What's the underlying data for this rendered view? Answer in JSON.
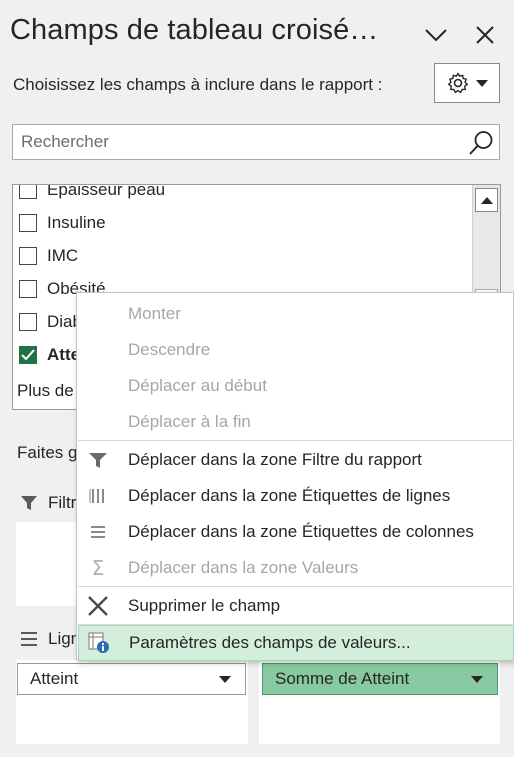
{
  "pane": {
    "title": "Champs de tableau croisé…",
    "choose_label": "Choisissez les champs à inclure dans le rapport :",
    "icons": {
      "collapse": "chevron-down-icon",
      "close": "close-icon",
      "settings": "gear-icon",
      "search": "search-icon"
    }
  },
  "search": {
    "placeholder": "Rechercher",
    "value": ""
  },
  "fields": [
    {
      "label": "Épaisseur peau",
      "checked": false
    },
    {
      "label": "Insuline",
      "checked": false
    },
    {
      "label": "IMC",
      "checked": false
    },
    {
      "label": "Obésité",
      "checked": false
    },
    {
      "label": "Diab",
      "checked": false
    },
    {
      "label": "Atte",
      "checked": true
    }
  ],
  "more_tables": "Plus de",
  "drag_label": "Faites g",
  "areas": {
    "filters_label": "Filtr",
    "rows_label": "Lign",
    "rows_field": "Atteint",
    "values_field": "Somme de Atteint"
  },
  "context_menu": {
    "items": [
      {
        "label": "Monter",
        "disabled": true
      },
      {
        "label": "Descendre",
        "disabled": true
      },
      {
        "label": "Déplacer au début",
        "disabled": true
      },
      {
        "label": "Déplacer à la fin",
        "disabled": true
      },
      {
        "label": "Déplacer dans la zone Filtre du rapport",
        "disabled": false,
        "icon": "filter-icon"
      },
      {
        "label": "Déplacer dans la zone Étiquettes de lignes",
        "disabled": false,
        "icon": "row-labels-icon"
      },
      {
        "label": "Déplacer dans la zone Étiquettes de colonnes",
        "disabled": false,
        "icon": "column-labels-icon"
      },
      {
        "label": "Déplacer dans la zone Valeurs",
        "disabled": true,
        "icon": "sigma-icon"
      },
      {
        "label": "Supprimer le champ",
        "disabled": false,
        "icon": "remove-field-icon"
      },
      {
        "label": "Paramètres des champs de valeurs...",
        "disabled": false,
        "highlighted": true,
        "icon": "field-settings-icon"
      }
    ]
  },
  "colors": {
    "accent_green": "#217346",
    "menu_highlight": "#d3efdc",
    "selected_field": "#88c9a1"
  }
}
